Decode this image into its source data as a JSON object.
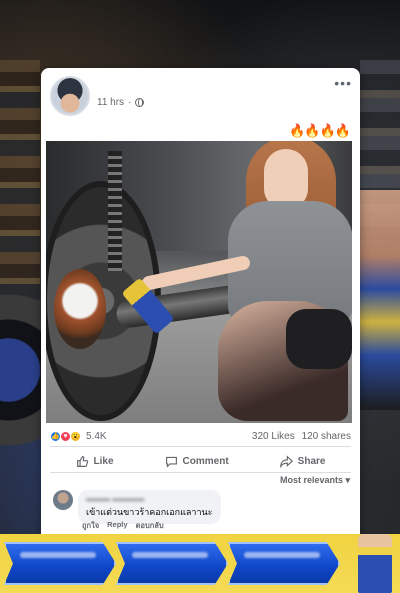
{
  "post": {
    "time": "11 hrs",
    "time_separator": "·",
    "more_label": "•••",
    "reaction_stickers": "🔥🔥🔥🔥"
  },
  "stats": {
    "reaction_icons": [
      "like",
      "love",
      "wow"
    ],
    "reaction_count": "5.4K",
    "likes": "320 Likes",
    "shares": "120 shares"
  },
  "actions": {
    "like": "Like",
    "comment": "Comment",
    "share": "Share"
  },
  "comments": {
    "sort_label": "Most relevants ▾",
    "items": [
      {
        "text": "เข้าแต่วนขาวร้าคอกเอกแลาานะ",
        "actions": [
          "ถูกใจ",
          "Reply",
          "ตอบกลับ"
        ]
      }
    ]
  },
  "colors": {
    "accent": "#1877f2",
    "promo_bg": "#f1d341",
    "promo_button": "#1f5ee0"
  }
}
